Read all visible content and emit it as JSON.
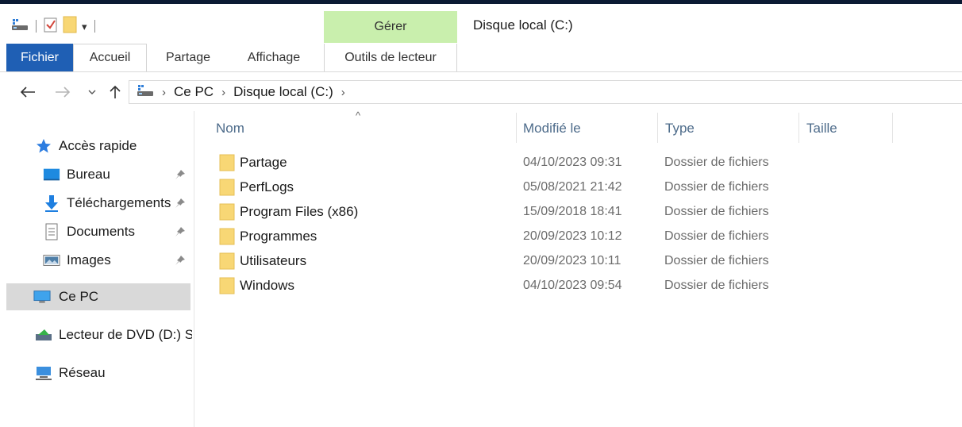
{
  "window": {
    "title": "Disque local (C:)"
  },
  "ribbon": {
    "contextual_group": "Gérer",
    "tabs": [
      {
        "label": "Fichier"
      },
      {
        "label": "Accueil"
      },
      {
        "label": "Partage"
      },
      {
        "label": "Affichage"
      },
      {
        "label": "Outils de lecteur"
      }
    ]
  },
  "address": {
    "breadcrumbs": [
      {
        "label": "Ce PC"
      },
      {
        "label": "Disque local (C:)"
      }
    ]
  },
  "sidebar": {
    "quick_access": "Accès rapide",
    "pinned": [
      {
        "label": "Bureau",
        "icon": "desktop-icon"
      },
      {
        "label": "Téléchargements",
        "icon": "download-arrow-icon"
      },
      {
        "label": "Documents",
        "icon": "document-icon"
      },
      {
        "label": "Images",
        "icon": "pictures-icon"
      }
    ],
    "this_pc": "Ce PC",
    "dvd": "Lecteur de DVD (D:) S",
    "network": "Réseau"
  },
  "columns": {
    "name": "Nom",
    "modified": "Modifié le",
    "type": "Type",
    "size": "Taille"
  },
  "files": [
    {
      "name": "Partage",
      "modified": "04/10/2023 09:31",
      "type": "Dossier de fichiers",
      "size": ""
    },
    {
      "name": "PerfLogs",
      "modified": "05/08/2021 21:42",
      "type": "Dossier de fichiers",
      "size": ""
    },
    {
      "name": "Program Files (x86)",
      "modified": "15/09/2018 18:41",
      "type": "Dossier de fichiers",
      "size": ""
    },
    {
      "name": "Programmes",
      "modified": "20/09/2023 10:12",
      "type": "Dossier de fichiers",
      "size": ""
    },
    {
      "name": "Utilisateurs",
      "modified": "20/09/2023 10:11",
      "type": "Dossier de fichiers",
      "size": ""
    },
    {
      "name": "Windows",
      "modified": "04/10/2023 09:54",
      "type": "Dossier de fichiers",
      "size": ""
    }
  ],
  "colors": {
    "file_tab": "#1f5fb4",
    "manage_band": "#c9efad",
    "column_header_text": "#4d6b8a",
    "selected_nav": "#d9d9d9",
    "folder_yellow": "#f8d775"
  }
}
